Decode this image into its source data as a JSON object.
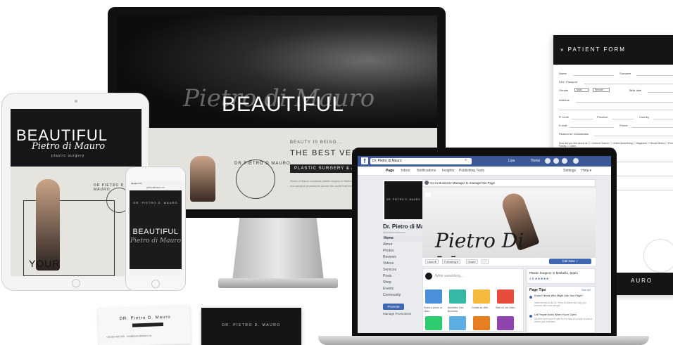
{
  "imac": {
    "hero_title": "BEAUTIFUL",
    "script": "Pietro di Mauro",
    "kicker": "BEAUTY IS BEING...",
    "headline": "THE BEST VERSION O",
    "band": "PLASTIC SURGERY & AESTHE",
    "copy": "Pietro di Mauro conducts plastic surgery in Marbella, Spain. Look natural. Dr Mauro performs both surgical and non-surgical procedures across the world that beautiful, confident and happy in their",
    "seal": "DR PIETRO D MAURO"
  },
  "ipad": {
    "title": "BEAUTIFUL",
    "script": "Pietro di Mauro",
    "tag": "plastic surgery",
    "seal": "DR PIETRO D MAURO",
    "your": "YOUR"
  },
  "iphone": {
    "status": "●●●●● 9:41",
    "url": "pietrodimauro.es",
    "brand": "DR. PIETRO D. MAURO",
    "title": "BEAUTIFUL",
    "script": "Pietro di Mauro"
  },
  "cards": {
    "white_name": "DR. Pietro D. Mauro",
    "white_info": "+34 000 000 000 · info@pietrodimauro.es",
    "black_name": "DR. PIETRO D. MAURO"
  },
  "patient_form": {
    "title": "» PATIENT FORM",
    "fields": {
      "name": "Name",
      "surname": "Surname",
      "dni": "DNI / Passport",
      "gender": "Gender",
      "male": "Male",
      "female": "Female",
      "birth": "Birth date",
      "address": "Address",
      "pcode": "P. Code",
      "province": "Province",
      "country": "Country",
      "email": "E-mail",
      "phone": "Phone",
      "reason": "Reason for consultation"
    },
    "question": "How did you find about us? ☐ Internet Search ☐ Online Advertising ☐ Magazine ☐ Social Media ☐ Friend / Family ☐ Other",
    "footer": "AURO"
  },
  "facebook": {
    "search_value": "Dr. Pietro di Mauro",
    "user": "Lisa",
    "home": "Home",
    "nav": [
      "Page",
      "Inbox",
      "Notifications",
      "Insights",
      "Publishing Tools"
    ],
    "nav_right": [
      "Settings",
      "Help ▾"
    ],
    "page_name": "Dr. Pietro di Mauro",
    "handle": "@drpietrodimauro",
    "left_menu": [
      "Home",
      "About",
      "Photos",
      "Reviews",
      "Videos",
      "Services",
      "Posts",
      "Shop",
      "Events",
      "Community"
    ],
    "promote": "Promote",
    "manage": "Manage Promotions",
    "biz_bar": "Go to Business Manager to manage this Page",
    "profile_pic_text": "DR. PIETRO D. MAURO",
    "cover_script": "Pietro Di Mauro",
    "actions": [
      "Liked ▾",
      "Following ▾",
      "Share",
      "···"
    ],
    "call_now": "Call Now ✓",
    "composer": "Write something...",
    "tiles": [
      {
        "label": "Share a photo or video",
        "color": "#4a90d9"
      },
      {
        "label": "Advertise Your Business",
        "color": "#37b7a6"
      },
      {
        "label": "Create an offer",
        "color": "#f6b93b"
      },
      {
        "label": "Start a Live Video",
        "color": "#e74c3c"
      }
    ],
    "location": "Plastic Surgeon in Marbella, Spain",
    "rating": "4.9 ★★★★★",
    "tips_title": "Page Tips",
    "tips_seeall": "See All",
    "tips": [
      {
        "title": "Know Friends Who Might Like Your Page?",
        "sub": "Invite friends to like Dr. Pietro di Mauro and help you connect with more people."
      },
      {
        "title": "Let People Know When You're Open",
        "sub": "Add the hours you're open so it's easy for people to plan a visit to your business."
      }
    ]
  }
}
